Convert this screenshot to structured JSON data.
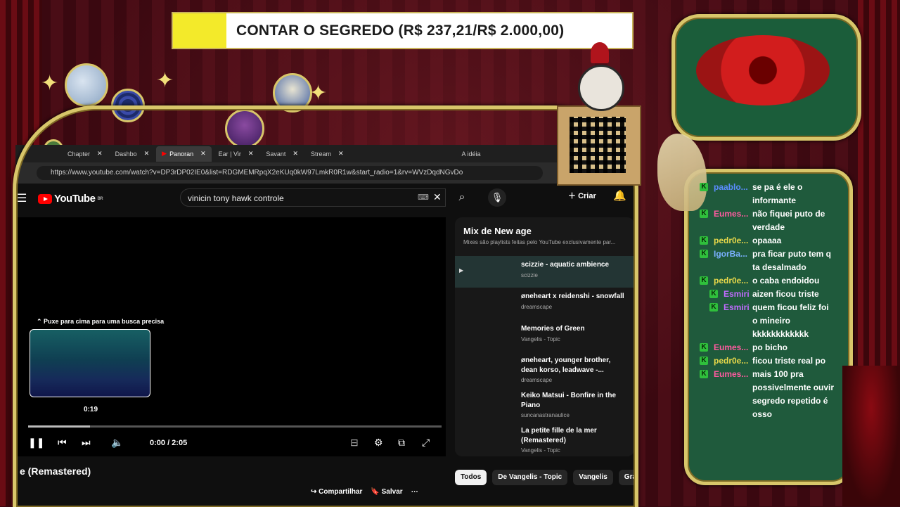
{
  "goal": {
    "text": "CONTAR O SEGREDO (R$ 237,21/R$ 2.000,00)",
    "progress_fraction": 0.1186
  },
  "browser": {
    "tabs": [
      {
        "label": "Chapter"
      },
      {
        "label": "Dashbo"
      },
      {
        "label": "Panoran"
      },
      {
        "label": "Ear | Vir"
      },
      {
        "label": "Savant"
      },
      {
        "label": "Stream"
      },
      {
        "label": "A idéia"
      }
    ],
    "url": "https://www.youtube.com/watch?v=DP3rDP02IE0&list=RDGMEMRpqX2eKUq0kW97LmkR0R1w&start_radio=1&rv=WVzDqdNGvDo"
  },
  "youtube": {
    "logo": "YouTube",
    "region": "BR",
    "search_value": "vinicin tony hawk controle",
    "create_label": "Criar",
    "player": {
      "hint": "Puxe para cima para uma busca precisa",
      "thumb_time": "0:19",
      "time": "0:00 / 2:05",
      "progress_fraction": 0.15
    },
    "video_title": "e (Remastered)",
    "actions": {
      "share": "Compartilhar",
      "save": "Salvar"
    },
    "chips": [
      "Todos",
      "De Vangelis - Topic",
      "Vangelis",
      "Grav"
    ],
    "playlist": {
      "title": "Mix de New age",
      "subtitle": "Mixes são playlists feitas pelo YouTube exclusivamente par...",
      "items": [
        {
          "title": "scizzie - aquatic ambience",
          "channel": "scizzie",
          "selected": true
        },
        {
          "title": "øneheart x reidenshi - snowfall",
          "channel": "dreamscape"
        },
        {
          "title": "Memories of Green",
          "channel": "Vangelis - Topic"
        },
        {
          "title": "øneheart, younger brother, dean korso, leadwave -...",
          "channel": "dreamscape"
        },
        {
          "title": "Keiko Matsui - Bonfire in the Piano",
          "channel": "suncanastranaulice"
        },
        {
          "title": "La petite fille de la mer (Remastered)",
          "channel": "Vangelis - Topic"
        }
      ]
    }
  },
  "chat": {
    "badge": "K",
    "messages": [
      {
        "user": "paablo...",
        "color": "#5b8cff",
        "lines": [
          "se pa é ele o",
          "informante"
        ]
      },
      {
        "user": "Eumes...",
        "color": "#ff5aa0",
        "lines": [
          "não fiquei puto de",
          "verdade"
        ]
      },
      {
        "user": "pedr0e...",
        "color": "#e9d94a",
        "lines": [
          "opaaaa"
        ]
      },
      {
        "user": "IgorBa...",
        "color": "#7ab0ff",
        "lines": [
          "pra ficar puto tem q",
          "ta desalmado"
        ]
      },
      {
        "user": "pedr0e...",
        "color": "#e9d94a",
        "lines": [
          "o caba endoidou"
        ]
      },
      {
        "user": "Esmiri",
        "color": "#c06bff",
        "lines": [
          "aizen ficou triste"
        ],
        "indent": true
      },
      {
        "user": "Esmiri",
        "color": "#c06bff",
        "lines": [
          "quem ficou feliz foi",
          "o mineiro",
          "kkkkkkkkkkkk"
        ],
        "indent": true
      },
      {
        "user": "Eumes...",
        "color": "#ff5aa0",
        "lines": [
          "po bicho"
        ]
      },
      {
        "user": "pedr0e...",
        "color": "#e9d94a",
        "lines": [
          "ficou triste real po"
        ]
      },
      {
        "user": "Eumes...",
        "color": "#ff5aa0",
        "lines": [
          "mais 100 pra",
          "possivelmente ouvir",
          "segredo repetido é",
          "osso"
        ]
      }
    ]
  },
  "colors": {
    "gold": "#d8c66a",
    "goal_fill": "#f3ea2a",
    "youtube_red": "#ff0000",
    "chat_bg": "#1f5a3c"
  }
}
